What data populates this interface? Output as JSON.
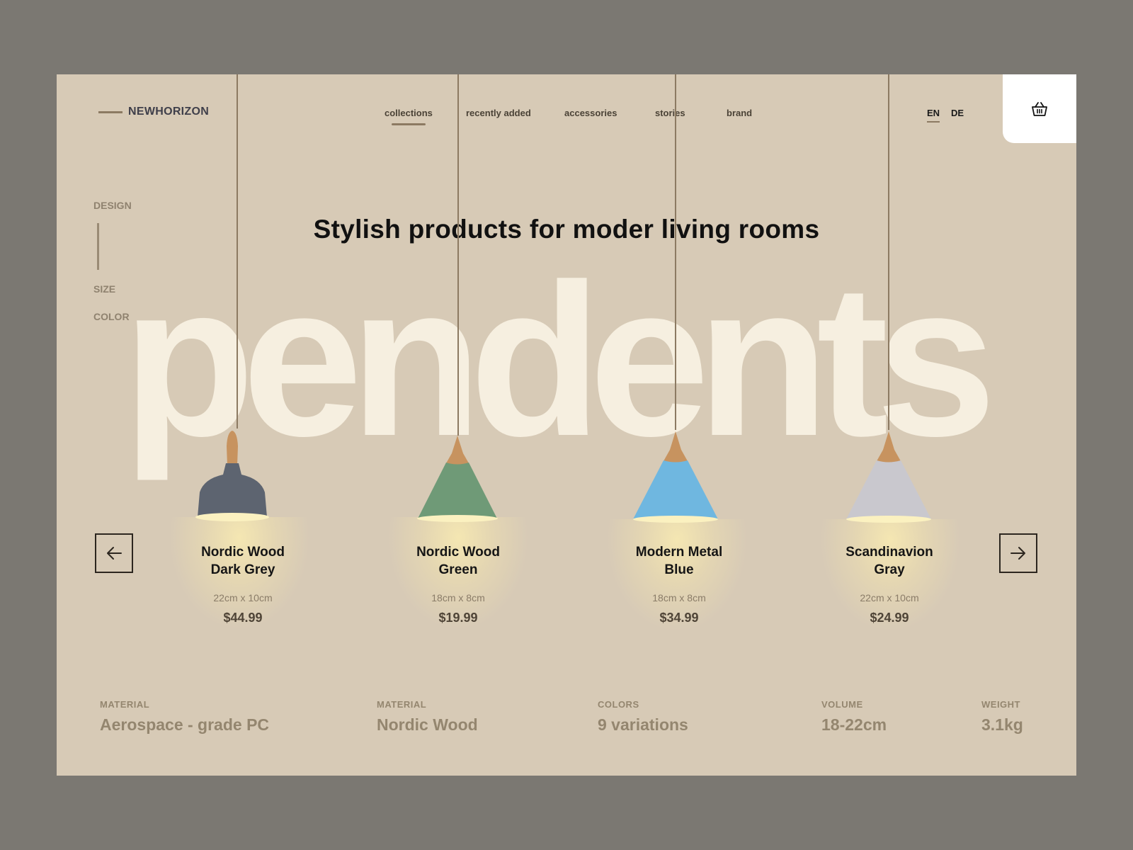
{
  "brand": {
    "name": "NEWHORIZON"
  },
  "nav": {
    "items": [
      "collections",
      "recently added",
      "accessories",
      "stories",
      "brand"
    ],
    "active": "collections"
  },
  "languages": {
    "items": [
      "EN",
      "DE"
    ],
    "active": "EN"
  },
  "cart": {
    "icon": "basket-icon"
  },
  "filters": {
    "items": [
      "DESIGN",
      "SIZE",
      "COLOR"
    ]
  },
  "hero": {
    "headline": "Stylish products for moder living rooms",
    "background_word": "pendents"
  },
  "products": [
    {
      "name": "Nordic Wood Dark Grey",
      "dims": "22cm x 10cm",
      "price": "$44.99",
      "color": "#5d6470"
    },
    {
      "name": "Nordic Wood Green",
      "dims": "18cm x 8cm",
      "price": "$19.99",
      "color": "#6f9a77"
    },
    {
      "name": "Modern Metal Blue",
      "dims": "18cm x 8cm",
      "price": "$34.99",
      "color": "#6fb7e0"
    },
    {
      "name": "Scandinavion Gray",
      "dims": "22cm x 10cm",
      "price": "$24.99",
      "color": "#c9c8ce"
    }
  ],
  "carousel": {
    "prev_icon": "arrow-left-icon",
    "next_icon": "arrow-right-icon"
  },
  "specs": [
    {
      "label": "MATERIAL",
      "value": "Aerospace - grade PC"
    },
    {
      "label": "MATERIAL",
      "value": "Nordic Wood"
    },
    {
      "label": "COLORS",
      "value": "9 variations"
    },
    {
      "label": "VOLUME",
      "value": "18-22cm"
    },
    {
      "label": "WEIGHT",
      "value": "3.1kg"
    }
  ],
  "colors": {
    "wood": "#c7935f",
    "accent": "#8c7a62",
    "background": "#d7cab6"
  }
}
